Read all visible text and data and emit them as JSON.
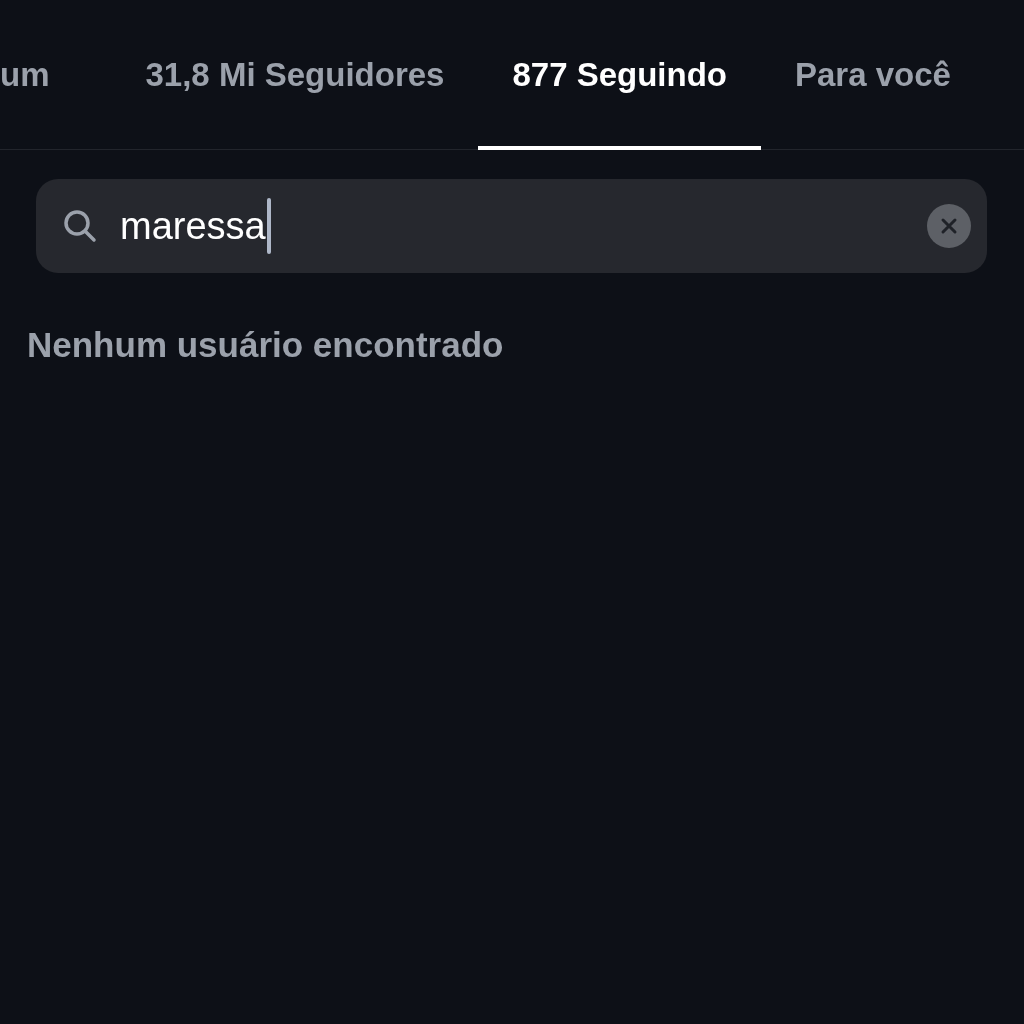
{
  "tabs": [
    {
      "label": "um",
      "selected": false
    },
    {
      "label": "31,8 Mi Seguidores",
      "selected": false
    },
    {
      "label": "877 Seguindo",
      "selected": true
    },
    {
      "label": "Para você",
      "selected": false
    }
  ],
  "search": {
    "value": "maressa"
  },
  "empty_message": "Nenhum usuário encontrado"
}
